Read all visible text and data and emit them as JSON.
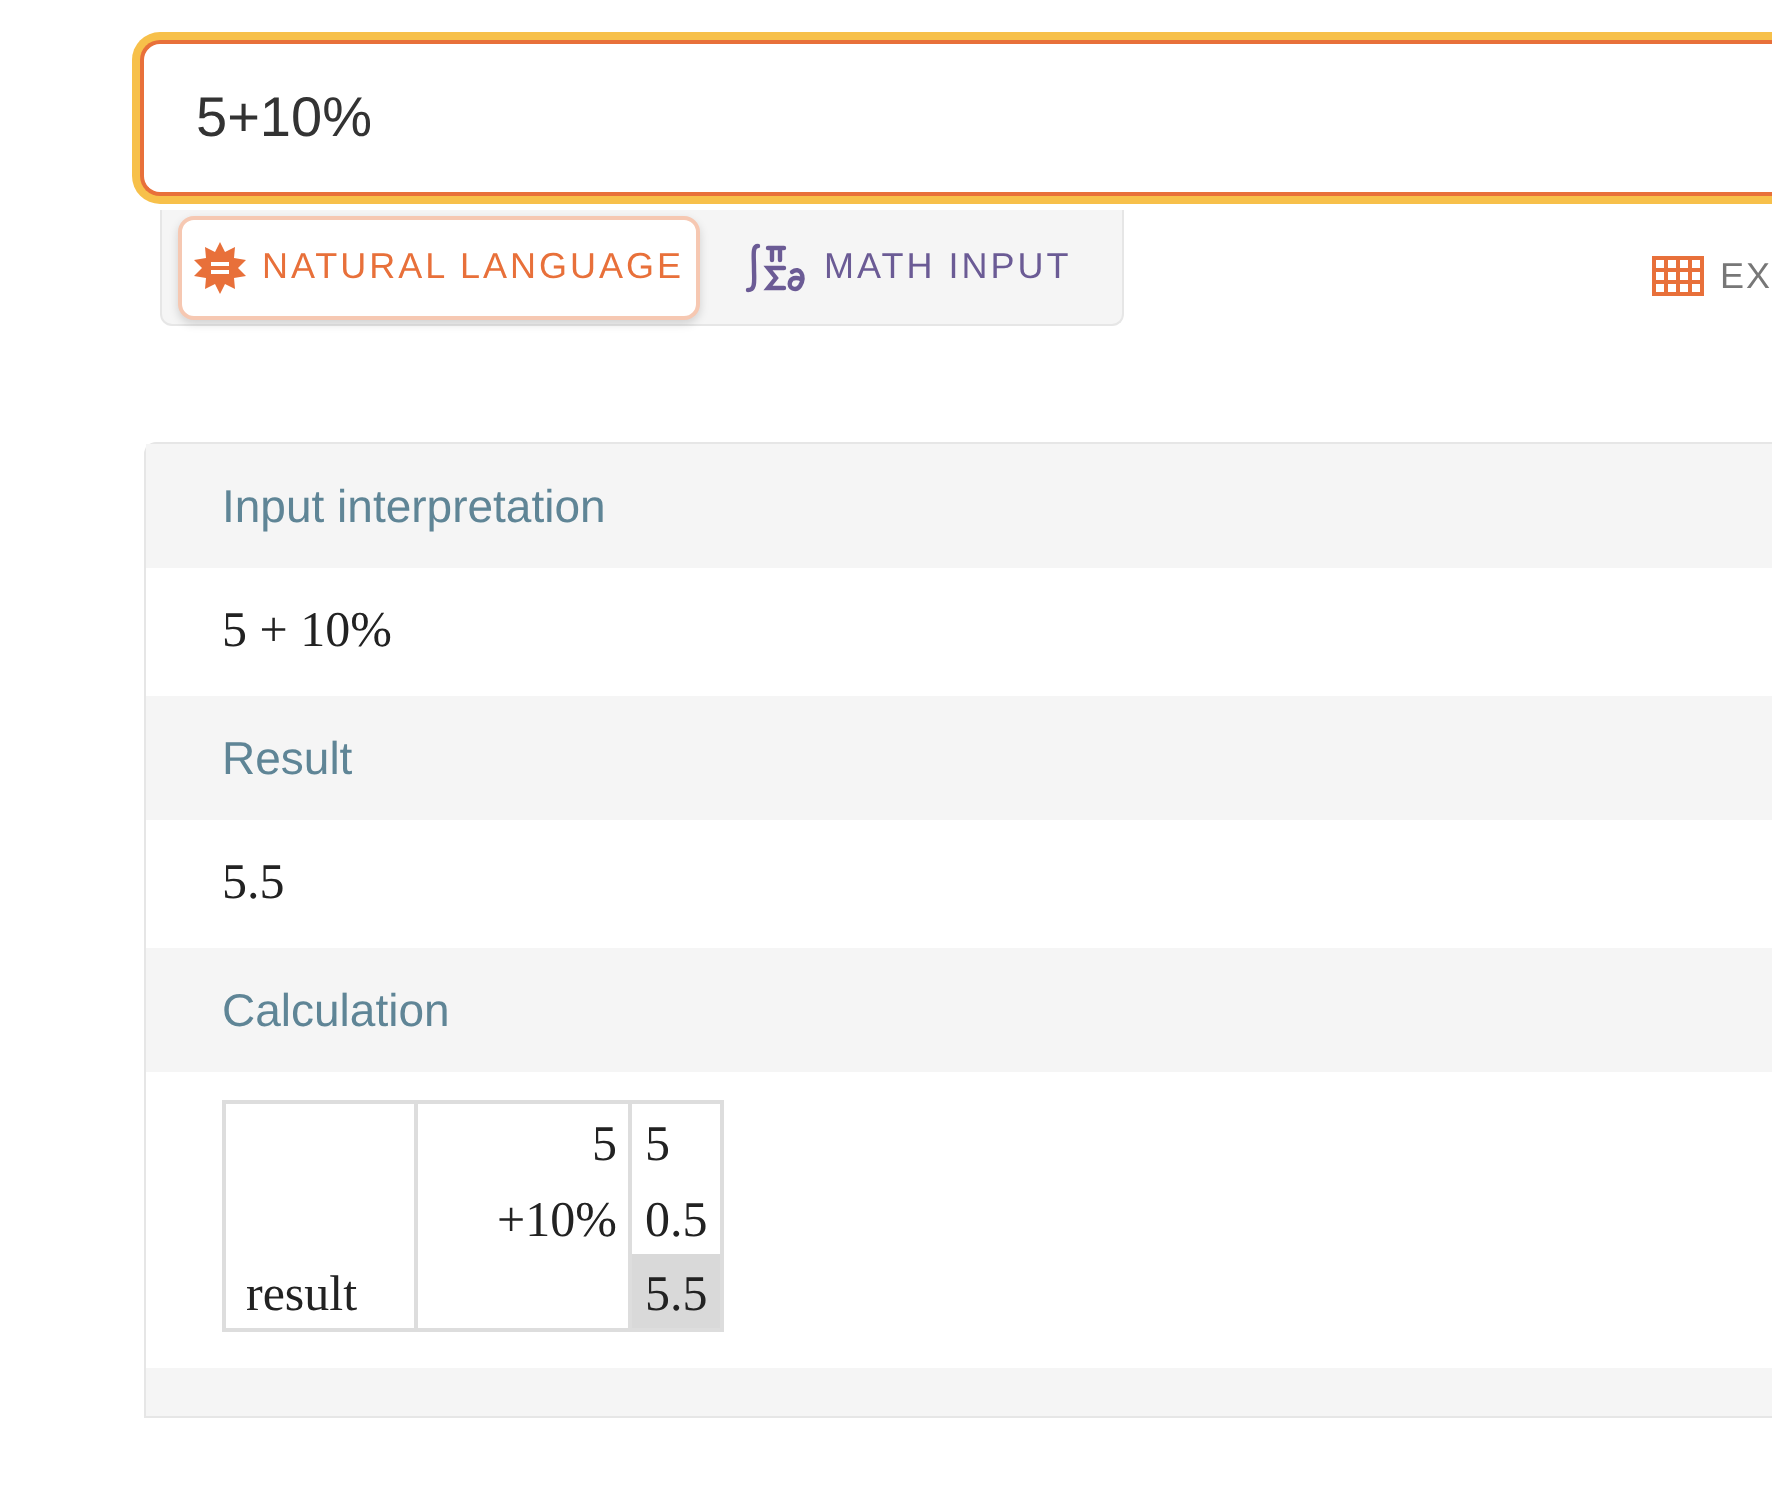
{
  "query": {
    "value": "5+10%"
  },
  "input_modes": [
    {
      "label": "NATURAL LANGUAGE",
      "kind": "natural",
      "selected": true
    },
    {
      "label": "MATH INPUT",
      "kind": "math",
      "selected": false
    }
  ],
  "extended_keyboard": {
    "label": "EX"
  },
  "pods": [
    {
      "title": "Input interpretation",
      "kind": "text",
      "content": "5 + 10%"
    },
    {
      "title": "Result",
      "kind": "text",
      "content": "5.5"
    },
    {
      "title": "Calculation",
      "kind": "calculation",
      "rows": [
        {
          "operand": "5",
          "value": "5",
          "highlighted": false
        },
        {
          "operand": "+10%",
          "value": "0.5",
          "highlighted": false
        },
        {
          "label": "result",
          "value": "5.5",
          "highlighted": true
        }
      ]
    },
    {
      "kind": "cut"
    }
  ]
}
